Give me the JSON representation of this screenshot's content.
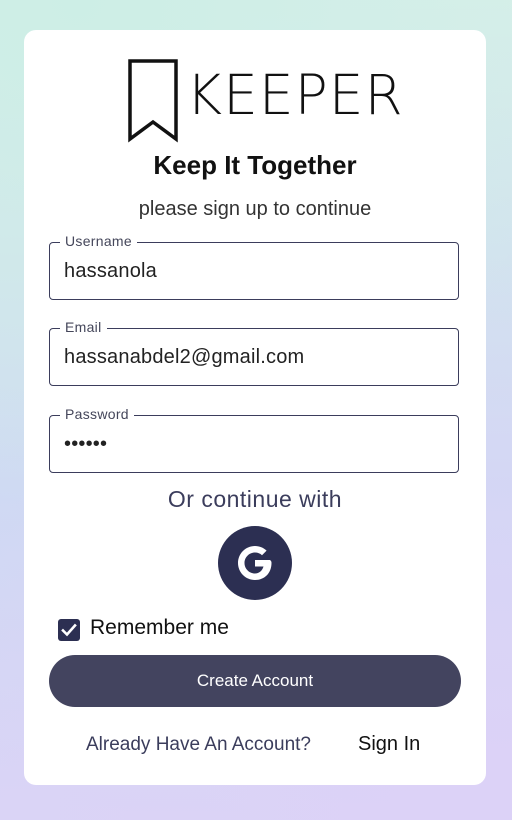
{
  "app": {
    "logo_text": "KEEPER",
    "tagline": "Keep It Together",
    "subtitle": "please sign up to continue"
  },
  "form": {
    "username": {
      "label": "Username",
      "value": "hassanola"
    },
    "email": {
      "label": "Email",
      "value": "hassanabdel2@gmail.com"
    },
    "password": {
      "label": "Password",
      "value": "••••••"
    }
  },
  "social": {
    "or_text": "Or continue with",
    "google_icon": "google-g-icon"
  },
  "remember": {
    "label": "Remember me",
    "checked": true
  },
  "actions": {
    "create_account": "Create Account",
    "already_text": "Already Have An Account?",
    "sign_in": "Sign In"
  },
  "colors": {
    "primary": "#2c2f52",
    "button": "#43445f",
    "card": "#ffffff"
  }
}
